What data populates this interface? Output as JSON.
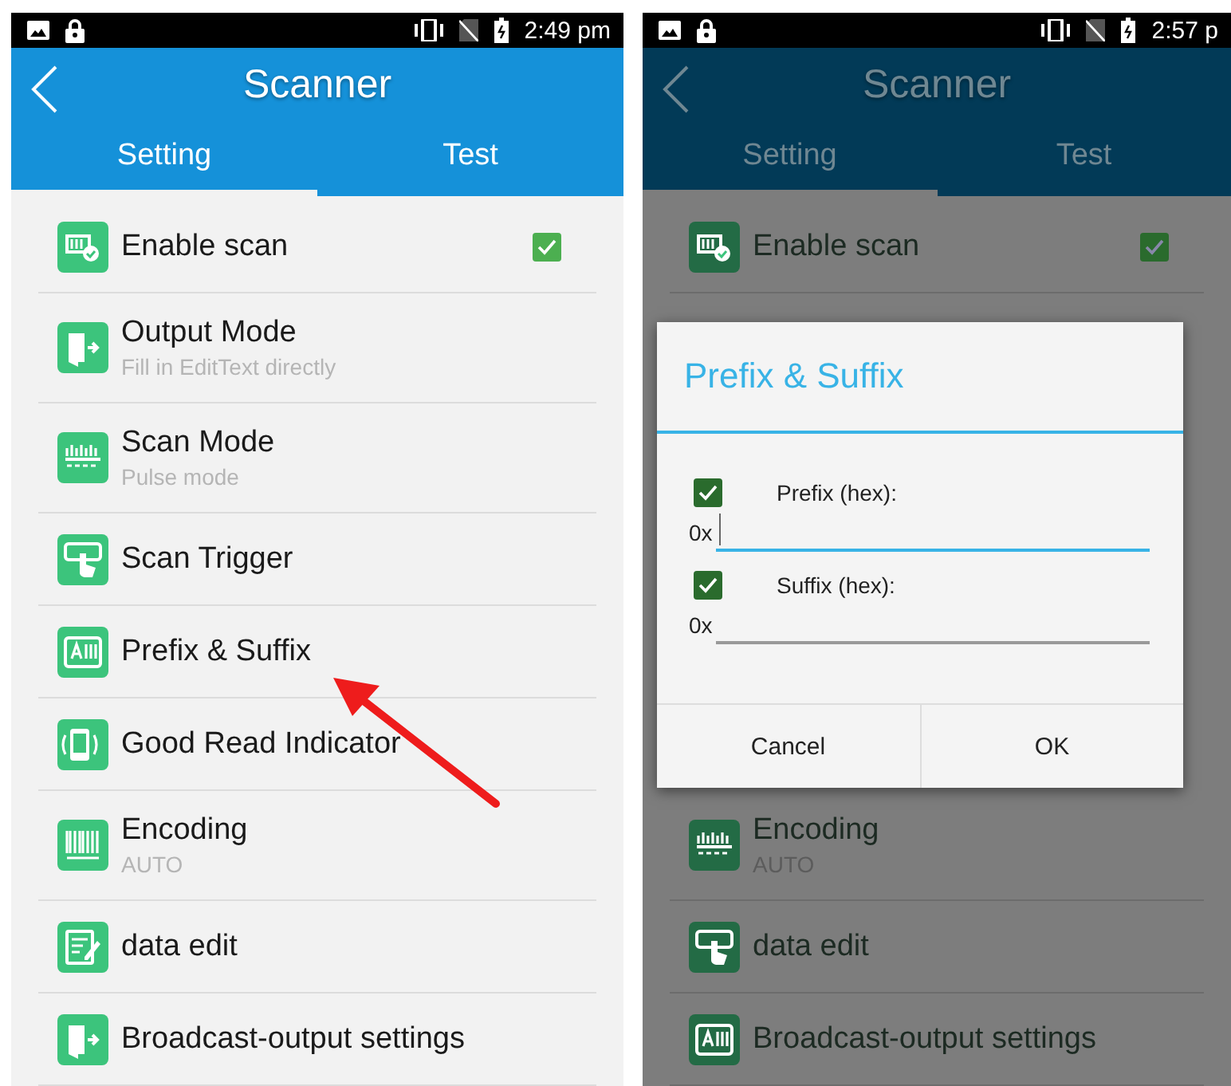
{
  "screens": [
    {
      "dimmed": false,
      "arrow": true,
      "status_bar": {
        "time": "2:49 pm"
      },
      "app_bar": {
        "title": "Scanner"
      },
      "tabs": [
        {
          "label": "Setting",
          "selected": true
        },
        {
          "label": "Test",
          "selected": false
        }
      ],
      "items": [
        {
          "kind": "toggle",
          "title": "Enable scan",
          "checked": true
        },
        {
          "kind": "detail",
          "title": "Output Mode",
          "subtitle": "Fill in EditText directly"
        },
        {
          "kind": "detail",
          "title": "Scan Mode",
          "subtitle": "Pulse mode"
        },
        {
          "kind": "simple",
          "title": "Scan Trigger"
        },
        {
          "kind": "simple",
          "title": "Prefix & Suffix"
        },
        {
          "kind": "simple",
          "title": "Good Read Indicator"
        },
        {
          "kind": "detail",
          "title": "Encoding",
          "subtitle": "AUTO"
        },
        {
          "kind": "simple",
          "title": "data edit"
        },
        {
          "kind": "simple",
          "title": "Broadcast-output settings"
        }
      ]
    },
    {
      "dimmed": true,
      "arrow": false,
      "status_bar": {
        "time": "2:57 p"
      },
      "app_bar": {
        "title": "Scanner"
      },
      "tabs": [
        {
          "label": "Setting",
          "selected": true
        },
        {
          "label": "Test",
          "selected": false
        }
      ],
      "items": [
        {
          "kind": "toggle",
          "title": "Enable scan",
          "checked": true
        },
        {
          "kind": "dialog",
          "title": "Prefix & Suffix",
          "fields": [
            {
              "label": "Prefix (hex):",
              "checked": true,
              "prefix": "0x",
              "focused": true
            },
            {
              "label": "Suffix (hex):",
              "checked": true,
              "prefix": "0x",
              "focused": false
            }
          ],
          "buttons": [
            "Cancel",
            "OK"
          ]
        },
        {
          "kind": "detail",
          "title": "Encoding",
          "subtitle": "AUTO"
        },
        {
          "kind": "simple",
          "title": "data edit"
        },
        {
          "kind": "simple",
          "title": "Broadcast-output settings"
        }
      ]
    }
  ]
}
